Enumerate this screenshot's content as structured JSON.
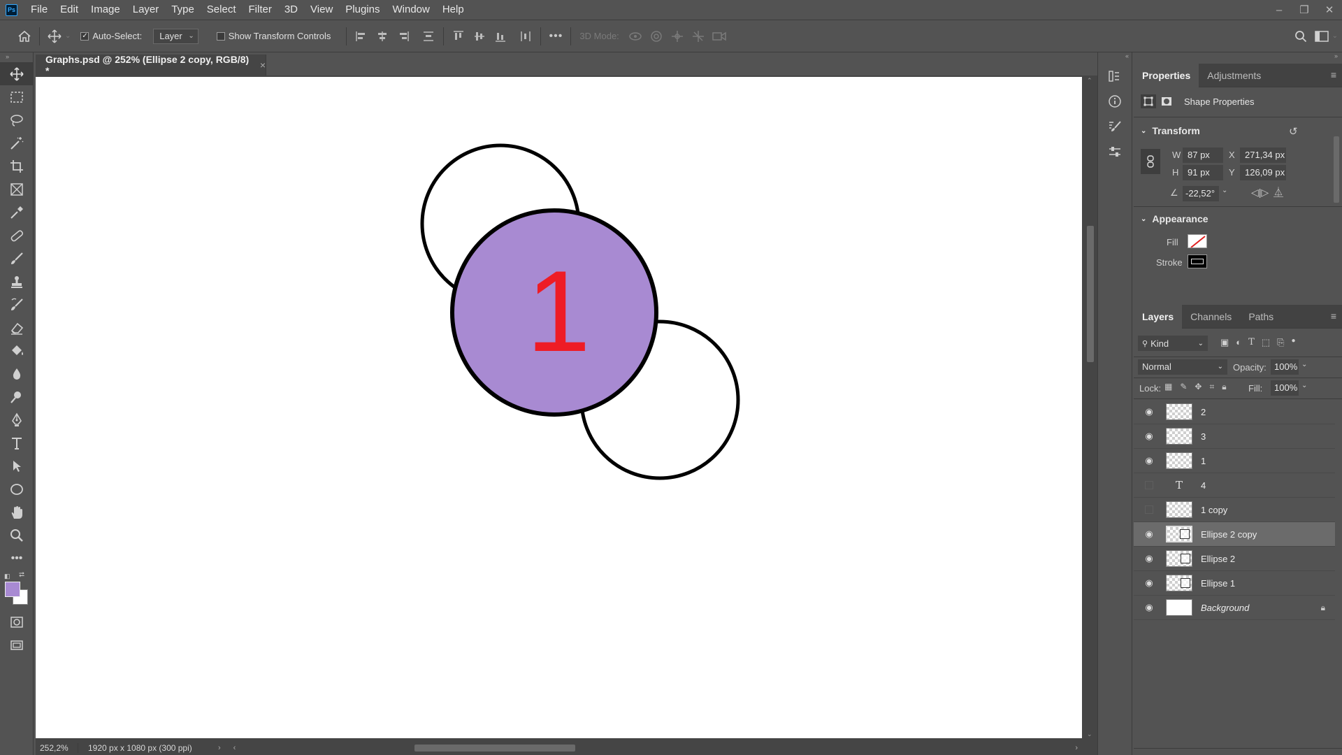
{
  "app": {
    "logo": "Ps"
  },
  "menu": [
    "File",
    "Edit",
    "Image",
    "Layer",
    "Type",
    "Select",
    "Filter",
    "3D",
    "View",
    "Plugins",
    "Window",
    "Help"
  ],
  "window_controls": {
    "minimize": "–",
    "restore": "❐",
    "close": "✕"
  },
  "options_bar": {
    "auto_select_label": "Auto-Select:",
    "auto_select_checked": true,
    "auto_select_target": "Layer",
    "transform_controls_label": "Show Transform Controls",
    "more": "•••",
    "mode_3d_label": "3D Mode:"
  },
  "document": {
    "tab_title": "Graphs.psd @ 252% (Ellipse 2 copy, RGB/8) *",
    "close": "×",
    "zoom": "252,2%",
    "info": "1920 px x 1080 px (300 ppi)",
    "canvas_text": "1",
    "colors": {
      "fill_circle": "#a88ad2",
      "number": "#ee1c25",
      "stroke": "#000000"
    }
  },
  "colors": {
    "foreground": "#a88ad2",
    "background": "#ffffff"
  },
  "properties": {
    "tabs": [
      "Properties",
      "Adjustments"
    ],
    "kind": "Shape Properties",
    "transform": {
      "title": "Transform",
      "w_label": "W",
      "w": "87 px",
      "x_label": "X",
      "x": "271,34 px",
      "h_label": "H",
      "h": "91 px",
      "y_label": "Y",
      "y": "126,09 px",
      "angle": "-22,52°"
    },
    "appearance": {
      "title": "Appearance",
      "fill_label": "Fill",
      "stroke_label": "Stroke"
    }
  },
  "layers_panel": {
    "tabs": [
      "Layers",
      "Channels",
      "Paths"
    ],
    "filter": "Kind",
    "blend_mode": "Normal",
    "opacity_label": "Opacity:",
    "opacity": "100%",
    "lock_label": "Lock:",
    "fill_label": "Fill:",
    "fill": "100%",
    "layers": [
      {
        "name": "2",
        "visible": true,
        "type": "pixel"
      },
      {
        "name": "3",
        "visible": true,
        "type": "pixel"
      },
      {
        "name": "1",
        "visible": true,
        "type": "pixel"
      },
      {
        "name": "4",
        "visible": false,
        "type": "text"
      },
      {
        "name": "1 copy",
        "visible": false,
        "type": "pixel"
      },
      {
        "name": "Ellipse 2 copy",
        "visible": true,
        "type": "shape",
        "selected": true
      },
      {
        "name": "Ellipse 2",
        "visible": true,
        "type": "shape"
      },
      {
        "name": "Ellipse 1",
        "visible": true,
        "type": "shape"
      },
      {
        "name": "Background",
        "visible": true,
        "type": "background",
        "locked": true
      }
    ]
  }
}
